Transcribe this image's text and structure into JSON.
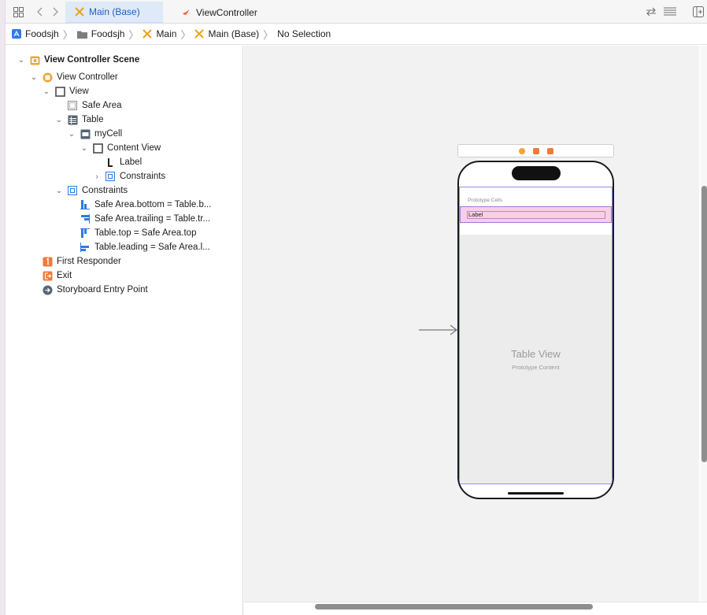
{
  "tabs": [
    {
      "label": "Main (Base)",
      "active": true,
      "icon": "storyboard-icon"
    },
    {
      "label": "ViewController",
      "active": false,
      "icon": "swift-icon"
    }
  ],
  "jumpbar": {
    "items": [
      {
        "label": "Foodsjh",
        "icon": "app-icon"
      },
      {
        "label": "Foodsjh",
        "icon": "folder-icon"
      },
      {
        "label": "Main",
        "icon": "storyboard-icon"
      },
      {
        "label": "Main (Base)",
        "icon": "storyboard-icon"
      },
      {
        "label": "No Selection",
        "icon": ""
      }
    ]
  },
  "outline": {
    "rows": [
      {
        "label": "View Controller Scene",
        "icon": "scene-icon"
      },
      {
        "label": "View Controller",
        "icon": "view-controller-icon"
      },
      {
        "label": "View",
        "icon": "view-icon"
      },
      {
        "label": "Safe Area",
        "icon": "safe-area-icon"
      },
      {
        "label": "Table",
        "icon": "table-icon"
      },
      {
        "label": "myCell",
        "icon": "cell-icon"
      },
      {
        "label": "Content View",
        "icon": "view-icon"
      },
      {
        "label": "Label",
        "icon": "label-icon"
      },
      {
        "label": "Constraints",
        "icon": "constraints-icon"
      },
      {
        "label": "Constraints",
        "icon": "constraints-icon"
      },
      {
        "label": "Safe Area.bottom = Table.b...",
        "icon": "constraint-bottom-icon"
      },
      {
        "label": "Safe Area.trailing = Table.tr...",
        "icon": "constraint-trailing-icon"
      },
      {
        "label": "Table.top = Safe Area.top",
        "icon": "constraint-top-icon"
      },
      {
        "label": "Table.leading = Safe Area.l...",
        "icon": "constraint-leading-icon"
      },
      {
        "label": "First Responder",
        "icon": "first-responder-icon"
      },
      {
        "label": "Exit",
        "icon": "exit-icon"
      },
      {
        "label": "Storyboard Entry Point",
        "icon": "entry-point-icon"
      }
    ]
  },
  "canvas": {
    "prototype_cells_label": "Prototype Cells",
    "cell_label": "Label",
    "table_view_title": "Table View",
    "table_view_subtitle": "Prototype Content"
  },
  "colors": {
    "accent": "#1f5fbf",
    "cell_fill": "#f7cfe7",
    "table_border": "#8f93e6"
  }
}
